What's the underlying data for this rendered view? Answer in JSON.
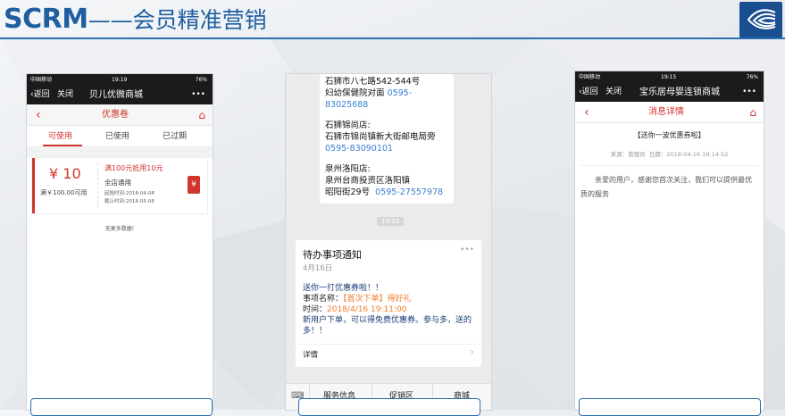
{
  "header": {
    "brand": "SCRM",
    "dash": "——",
    "subtitle": "会员精准营销"
  },
  "phone1": {
    "status": {
      "carrier": "中国移动",
      "time": "19:19",
      "battery": "76%"
    },
    "nav": {
      "back": "返回",
      "close": "关闭",
      "title": "贝儿优微商城",
      "more": "•••"
    },
    "subheader": {
      "title": "优惠卷"
    },
    "tabs": [
      {
        "label": "可使用"
      },
      {
        "label": "已使用"
      },
      {
        "label": "已过期"
      }
    ],
    "coupon": {
      "amount": "¥ 10",
      "condition": "满￥100.00可用",
      "headline": "满100元抵用10元",
      "scope": "全店通用",
      "start": "起始时间:2018-04-08",
      "end": "截止时间:2018-05-08",
      "icon_char": "¥"
    },
    "empty_text": "无更多数据!"
  },
  "phone2": {
    "chat": {
      "line0": "石狮市八七路542-544号",
      "line1": "妇幼保健院对面",
      "phone1": "0595-",
      "phone1b": "83025688",
      "store2_name": "石狮锦尚店:",
      "store2_addr": "石狮市锦尚镇新大街邮电局旁",
      "store2_phone": "0595-83090101",
      "store3_name": "泉州洛阳店:",
      "store3_addr": "泉州台商投资区洛阳镇",
      "store3_addr2": "昭阳街29号",
      "store3_phone": "0595-27557978"
    },
    "timestamp": "19:32",
    "notice": {
      "title": "待办事项通知",
      "date": "4月16日",
      "more": "•••",
      "line1": "送你一打优惠券啦！！",
      "item_label": "事项名称：",
      "item_value": "【首次下单】得好礼",
      "time_label": "时间：",
      "time_value": "2018/4/16 19:11:00",
      "desc": "新用户下单，可以得免费优惠券。参与多，送的多！！",
      "detail": "详情",
      "arrow": "›"
    },
    "menu": [
      {
        "label": "服务信息"
      },
      {
        "label": "促销区"
      },
      {
        "label": "商城"
      }
    ]
  },
  "phone3": {
    "status": {
      "carrier": "中国移动",
      "time": "19:15",
      "battery": "76%"
    },
    "nav": {
      "back": "返回",
      "close": "关闭",
      "title": "宝乐居母婴连锁商城",
      "more": "•••"
    },
    "subheader": {
      "title": "消息详情"
    },
    "article": {
      "title": "【送你一波优惠券啦】",
      "meta_source": "来源：管理员",
      "meta_date": "日期：2018-04-16 19:14:52",
      "body": "亲爱的用户，感谢您首次关注，我们可以提供最优质的服务"
    }
  },
  "colors": {
    "brand_blue": "#1f5fa0",
    "accent_red": "#d0342c",
    "link_blue": "#3a7fd0",
    "orange": "#f07c2a"
  }
}
